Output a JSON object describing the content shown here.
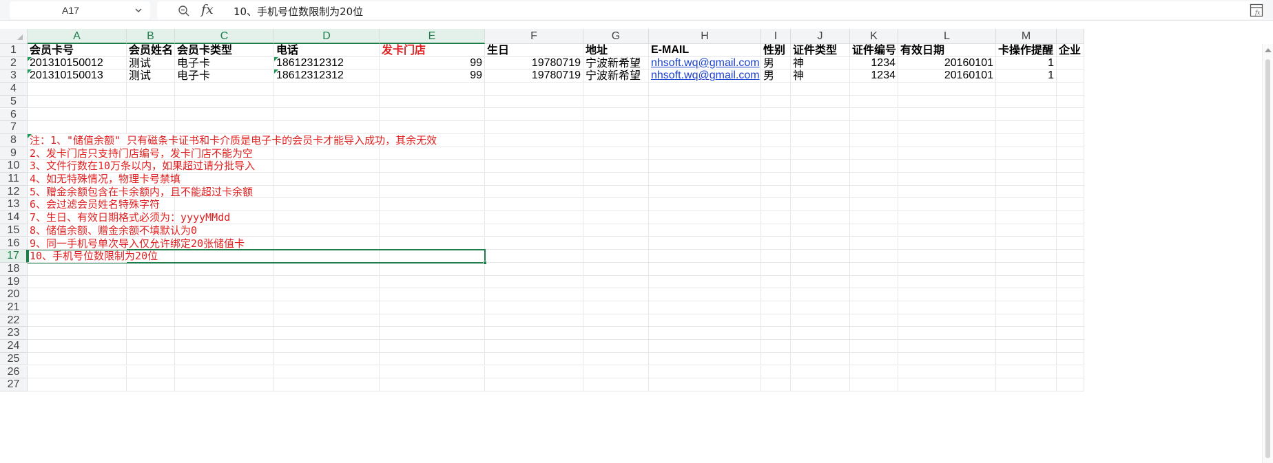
{
  "formula_bar": {
    "name_box": "A17",
    "fx_label": "fx",
    "content": "10、手机号位数限制为20位"
  },
  "column_headers": [
    "A",
    "B",
    "C",
    "D",
    "E",
    "F",
    "G",
    "H",
    "I",
    "J",
    "K",
    "L",
    "M",
    ""
  ],
  "row_headers": [
    "1",
    "2",
    "3",
    "4",
    "5",
    "6",
    "7",
    "8",
    "9",
    "10",
    "11",
    "12",
    "13",
    "14",
    "15",
    "16",
    "17",
    "18",
    "19",
    "20",
    "21",
    "22",
    "23",
    "24",
    "25",
    "26",
    "27"
  ],
  "selected_cell": "A17",
  "table": {
    "headers": [
      "会员卡号",
      "会员姓名",
      "会员卡类型",
      "电话",
      "发卡门店",
      "生日",
      "地址",
      "E-MAIL",
      "性别",
      "证件类型",
      "证件编号",
      "有效日期",
      "卡操作提醒",
      "企业"
    ],
    "rows": [
      [
        "201310150012",
        "测试",
        "电子卡",
        "18612312312",
        "99",
        "19780719",
        "宁波新希望",
        "nhsoft.wq@gmail.com",
        "男",
        "神",
        "1234",
        "20160101",
        "1",
        ""
      ],
      [
        "201310150013",
        "测试",
        "电子卡",
        "18612312312",
        "99",
        "19780719",
        "宁波新希望",
        "nhsoft.wq@gmail.com",
        "男",
        "神",
        "1234",
        "20160101",
        "1",
        ""
      ]
    ]
  },
  "notes": [
    "注：1、\"储值余额\" 只有磁条卡证书和卡介质是电子卡的会员卡才能导入成功，其余无效",
    "2、发卡门店只支持门店编号，发卡门店不能为空",
    "3、文件行数在10万条以内，如果超过请分批导入",
    "4、如无特殊情况，物理卡号禁填",
    "5、赠金余额包含在卡余额内，且不能超过卡余额",
    "6、会过滤会员姓名特殊字符",
    "7、生日、有效日期格式必须为：yyyyMMdd",
    "8、储值余额、赠金余额不填默认为0",
    "9、同一手机号单次导入仅允许绑定20张储值卡",
    "10、手机号位数限制为20位"
  ],
  "colors": {
    "accent": "#1e7d4a",
    "note_text": "#e02020",
    "link": "#1a3fcf"
  }
}
